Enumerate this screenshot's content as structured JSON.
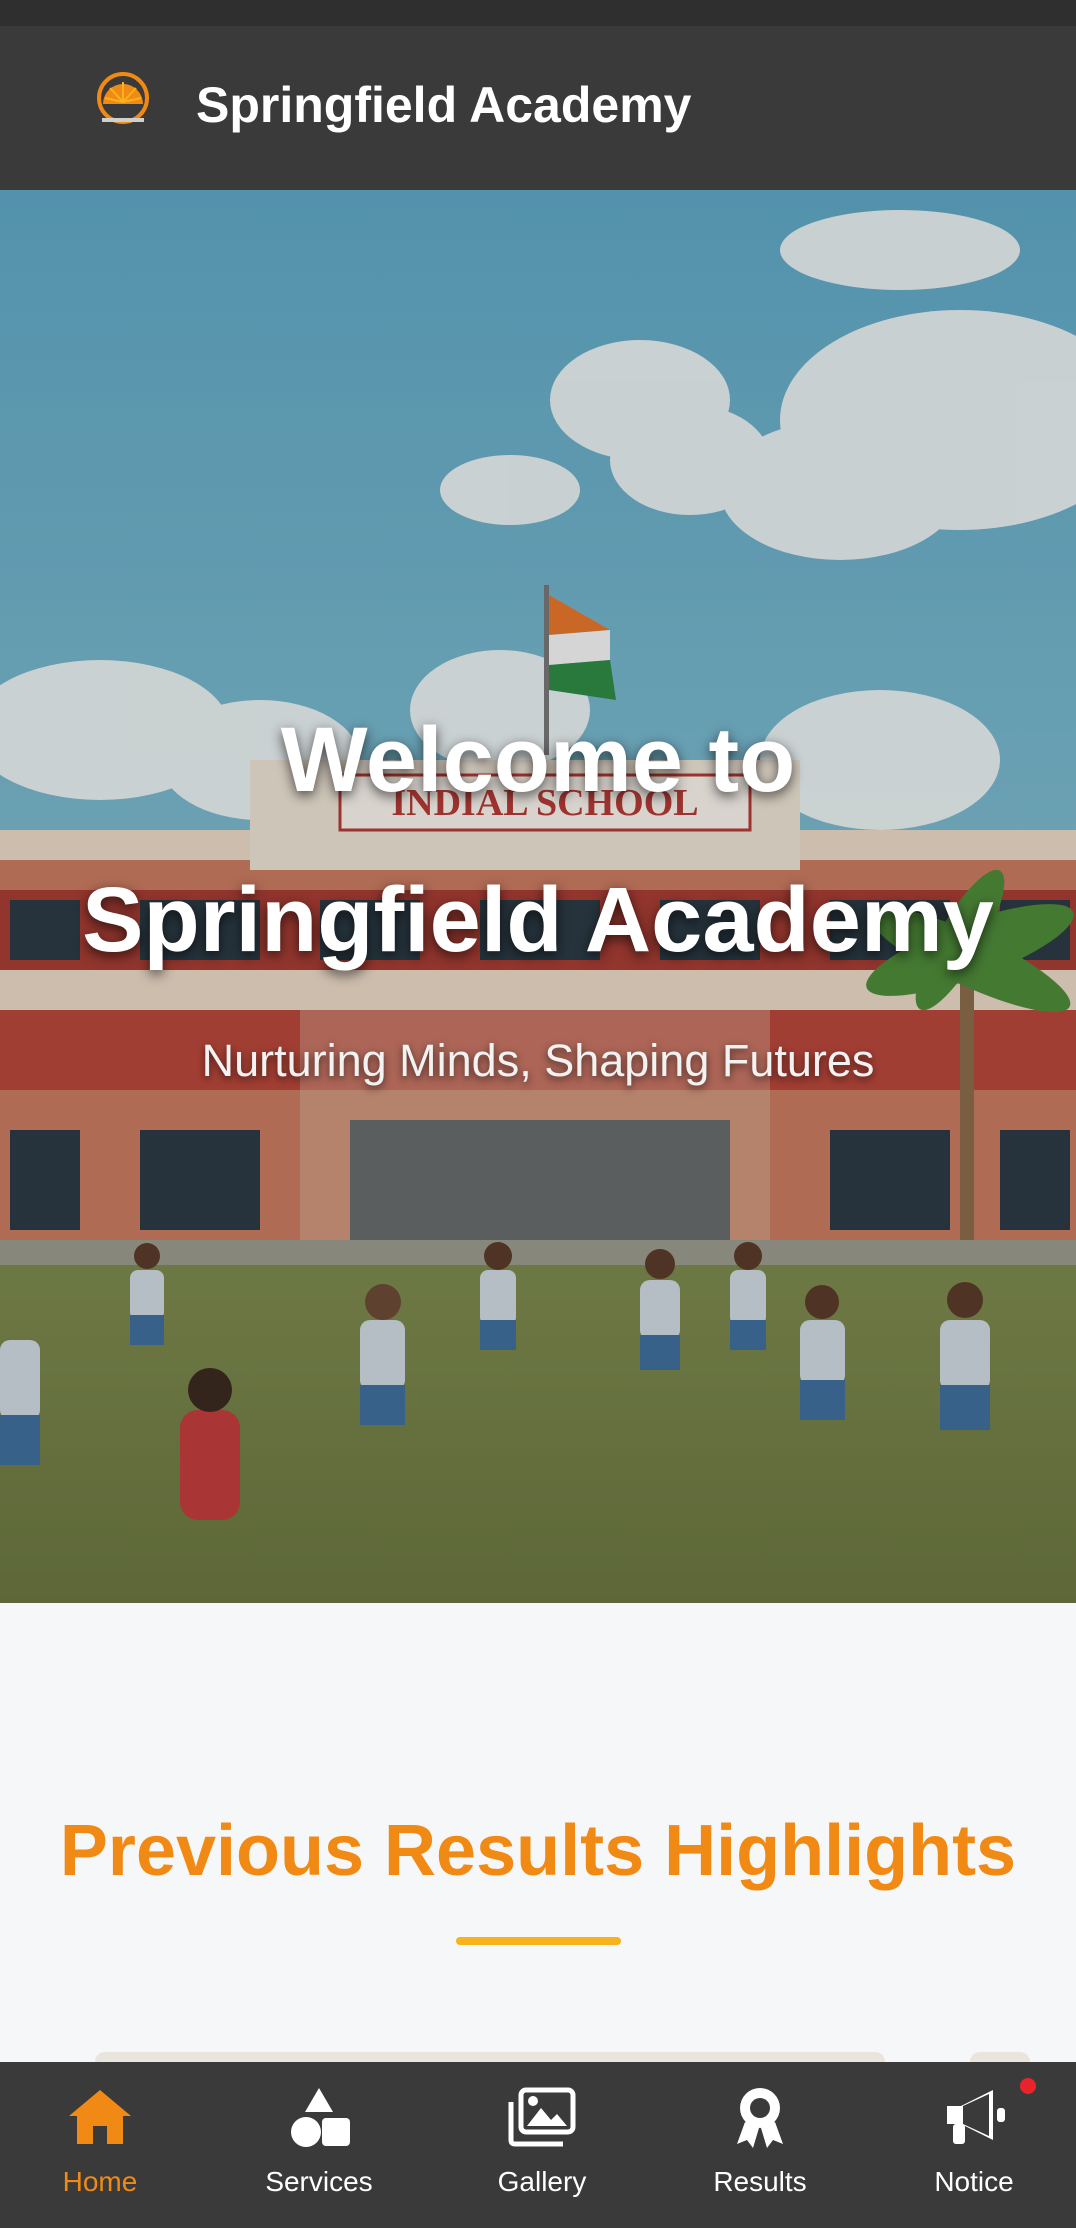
{
  "header": {
    "title": "Springfield Academy",
    "logo_icon": "sunburst-logo-icon"
  },
  "hero": {
    "title_line1": "Welcome to",
    "title_line2": "Springfield Academy",
    "subtitle": "Nurturing Minds, Shaping Futures",
    "school_sign": "INDIAL SCHOOL"
  },
  "section": {
    "title": "Previous Results Highlights"
  },
  "bottom_nav": {
    "items": [
      {
        "label": "Home",
        "icon": "home-icon",
        "active": true
      },
      {
        "label": "Services",
        "icon": "shapes-icon",
        "active": false
      },
      {
        "label": "Gallery",
        "icon": "images-icon",
        "active": false
      },
      {
        "label": "Results",
        "icon": "award-icon",
        "active": false
      },
      {
        "label": "Notice",
        "icon": "megaphone-icon",
        "active": false,
        "badge": true
      }
    ]
  },
  "colors": {
    "accent": "#f08a14",
    "underline": "#f7b21e",
    "header_bg": "#3a3a3a",
    "badge": "#e8232a"
  }
}
